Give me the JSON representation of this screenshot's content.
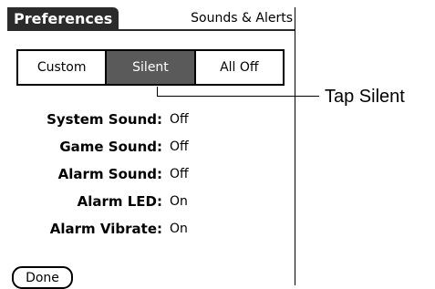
{
  "app": {
    "title": "Preferences",
    "category": "Sounds & Alerts"
  },
  "profile_selector": {
    "options": [
      {
        "label": "Custom",
        "selected": false
      },
      {
        "label": "Silent",
        "selected": true
      },
      {
        "label": "All Off",
        "selected": false
      }
    ]
  },
  "settings": [
    {
      "label": "System Sound:",
      "value": "Off"
    },
    {
      "label": "Game Sound:",
      "value": "Off"
    },
    {
      "label": "Alarm Sound:",
      "value": "Off"
    },
    {
      "label": "Alarm LED:",
      "value": "On"
    },
    {
      "label": "Alarm Vibrate:",
      "value": "On"
    }
  ],
  "done_label": "Done",
  "callout": {
    "text": "Tap Silent"
  },
  "colors": {
    "title_bar": "#2b2b2b",
    "selected_segment": "#5a5a5a"
  }
}
